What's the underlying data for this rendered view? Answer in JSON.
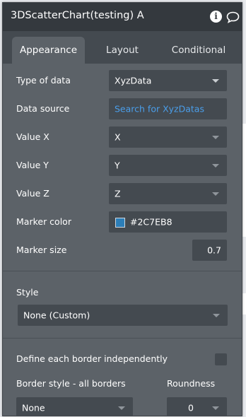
{
  "panel": {
    "title": "3DScatterChart(testing) A"
  },
  "tabs": [
    {
      "label": "Appearance",
      "active": true
    },
    {
      "label": "Layout",
      "active": false
    },
    {
      "label": "Conditional",
      "active": false
    }
  ],
  "properties": {
    "type_of_data": {
      "label": "Type of data",
      "value": "XyzData"
    },
    "data_source": {
      "label": "Data source",
      "value": "Search for XyzDatas"
    },
    "value_x": {
      "label": "Value X",
      "value": "X"
    },
    "value_y": {
      "label": "Value Y",
      "value": "Y"
    },
    "value_z": {
      "label": "Value Z",
      "value": "Z"
    },
    "marker_color": {
      "label": "Marker color",
      "value": "#2C7EB8",
      "swatch": "#2C7EB8"
    },
    "marker_size": {
      "label": "Marker size",
      "value": "0.7"
    }
  },
  "style": {
    "label": "Style",
    "value": "None (Custom)"
  },
  "border": {
    "independent_label": "Define each border independently",
    "independent_checked": false,
    "style_label": "Border style - all borders",
    "style_value": "None",
    "roundness_label": "Roundness",
    "roundness_value": "0"
  }
}
